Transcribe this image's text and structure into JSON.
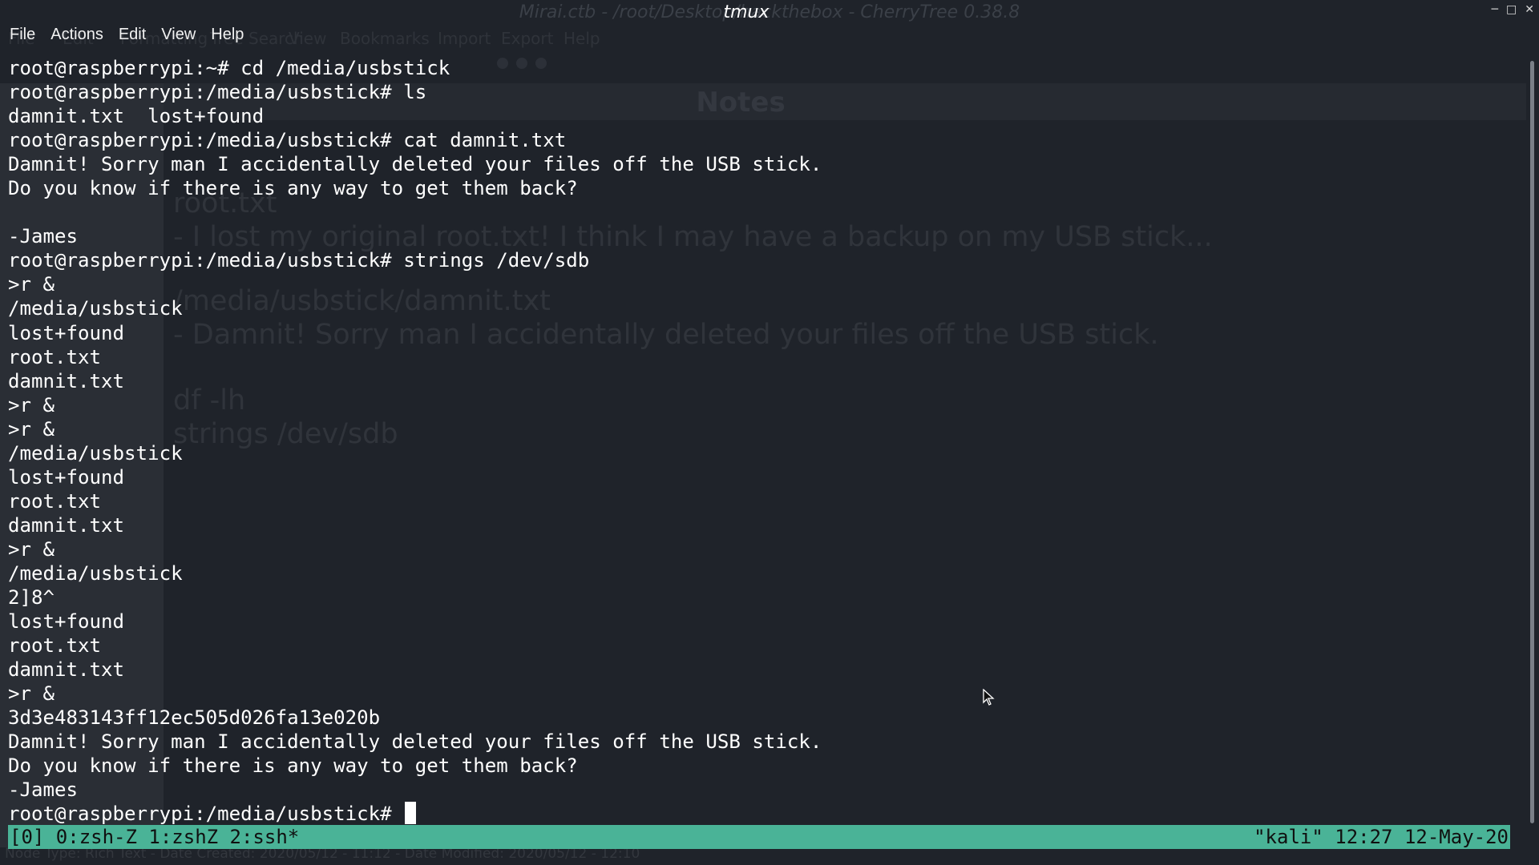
{
  "background_window": {
    "title": "Mirai.ctb - /root/Desktop/hackthebox - CherryTree 0.38.8",
    "menu": [
      "File",
      "Edit",
      "Formatting",
      "Tree",
      "Search",
      "View",
      "Bookmarks",
      "Import",
      "Export",
      "Help"
    ],
    "notes_title": "Notes",
    "note_lines": [
      "root.txt",
      "- I lost my original root.txt! I think I may have a backup on my USB stick...",
      "/media/usbstick/damnit.txt",
      "- Damnit! Sorry man I accidentally deleted your files off the USB stick.",
      "df -lh",
      "strings /dev/sdb"
    ],
    "status_text": "Node Type: Rich Text  -  Date Created: 2020/05/12 - 11:12  -  Date Modified: 2020/05/12 - 12:10"
  },
  "terminal": {
    "window_title": "tmux",
    "window_controls": [
      "minimize",
      "maximize",
      "close"
    ],
    "menu": [
      "File",
      "Actions",
      "Edit",
      "View",
      "Help"
    ],
    "lines": [
      "root@raspberrypi:~# cd /media/usbstick",
      "root@raspberrypi:/media/usbstick# ls",
      "damnit.txt  lost+found",
      "root@raspberrypi:/media/usbstick# cat damnit.txt",
      "Damnit! Sorry man I accidentally deleted your files off the USB stick.",
      "Do you know if there is any way to get them back?",
      "",
      "-James",
      "root@raspberrypi:/media/usbstick# strings /dev/sdb",
      ">r &",
      "/media/usbstick",
      "lost+found",
      "root.txt",
      "damnit.txt",
      ">r &",
      ">r &",
      "/media/usbstick",
      "lost+found",
      "root.txt",
      "damnit.txt",
      ">r &",
      "/media/usbstick",
      "2]8^",
      "lost+found",
      "root.txt",
      "damnit.txt",
      ">r &",
      "3d3e483143ff12ec505d026fa13e020b",
      "Damnit! Sorry man I accidentally deleted your files off the USB stick.",
      "Do you know if there is any way to get them back?",
      "-James"
    ],
    "prompt": "root@raspberrypi:/media/usbstick# ",
    "status_left": "[0] 0:zsh-Z 1:zshZ 2:ssh*",
    "status_right": "\"kali\" 12:27 12-May-20"
  },
  "colors": {
    "terminal_bg": "#1f232a",
    "status_bar": "#4ab397",
    "text": "#ffffff"
  },
  "icons": [
    "minimize-icon",
    "maximize-icon",
    "close-icon",
    "mouse-pointer-icon",
    "text-cursor"
  ]
}
